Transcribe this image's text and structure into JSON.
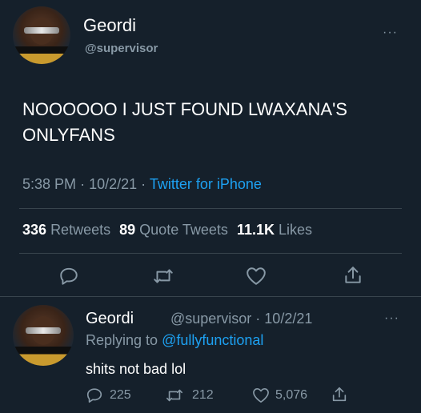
{
  "main_tweet": {
    "display_name": "Geordi",
    "handle": "@supervisor",
    "text_line1": "NOOOOOO I JUST FOUND LWAXANA'S",
    "text_line2": "ONLYFANS",
    "time": "5:38 PM",
    "sep1": "·",
    "date": "10/2/21",
    "sep2": "·",
    "source": "Twitter for iPhone",
    "retweets_count": "336",
    "retweets_label": "Retweets",
    "quotes_count": "89",
    "quotes_label": "Quote Tweets",
    "likes_count": "11.1K",
    "likes_label": "Likes",
    "more": "···"
  },
  "reply": {
    "display_name": "Geordi",
    "handle_date": "@supervisor · 10/2/21",
    "replying_label": "Replying to",
    "replying_to": "@fullyfunctional",
    "text": "shits not bad lol",
    "reply_count": "225",
    "retweet_count": "212",
    "like_count": "5,076",
    "more": "···"
  },
  "icons": {
    "reply": "reply-icon",
    "retweet": "retweet-icon",
    "like": "heart-icon",
    "share": "share-icon"
  },
  "colors": {
    "background": "#15202b",
    "muted": "#8899a6",
    "link": "#1da1f2",
    "divider": "#38444d"
  }
}
